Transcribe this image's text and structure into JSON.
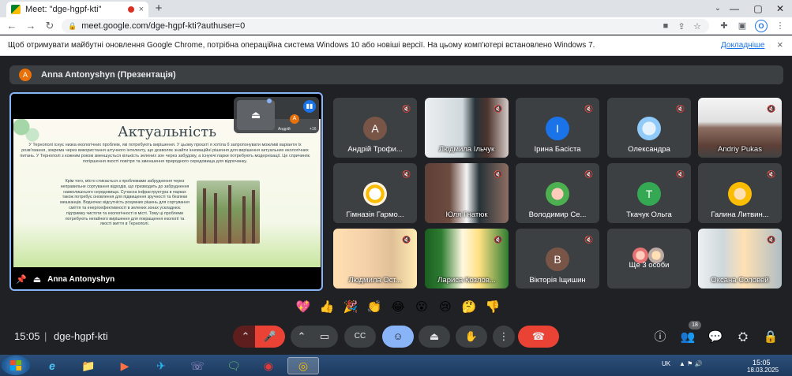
{
  "browser": {
    "tab_title": "Meet: \"dge-hgpf-kti\"",
    "tab_close": "×",
    "new_tab": "+",
    "url": "meet.google.com/dge-hgpf-kti?authuser=0",
    "profile_initial": "O",
    "icons": {
      "back": "←",
      "forward": "→",
      "reload": "↻",
      "lock": "🔒",
      "camera": "■",
      "share": "⇪",
      "star": "☆",
      "extensions": "✚",
      "sidebar": "▣",
      "menu": "⋮",
      "tab_search": "⌄",
      "minimize": "—",
      "maximize": "▢",
      "close": "✕"
    }
  },
  "infobar": {
    "message": "Щоб отримувати майбутні оновлення Google Chrome, потрібна операційна система Windows 10 або новіші версії. На цьому комп'ютері встановлено Windows 7.",
    "link": "Докладніше",
    "close": "×"
  },
  "meet": {
    "presenter_initial": "A",
    "presenter_banner": "Anna Antonyshyn (Презентація)",
    "presentation": {
      "presenter_name": "Anna Antonyshyn",
      "slide_title": "Актуальність",
      "slide_text_1": "У Тернополі існує низка екологічних проблем, які потребують вирішення. У цьому проєкті я хотіла б запропонувати можливі варіанти їх розв'язання, зокрема через використання штучного інтелекту, що дозволяє знайти інноваційні рішення для вирішення актуальних екологічних питань. У Тернополі з кожним роком зменшується кількість зелених зон через забудову, а існуючі парки потребують модернізації. Це спричиняє погіршення якості повітря та зменшення природного середовища для відпочинку.",
      "slide_text_2": "Крім того, місто стикається з проблемами забруднення через неправильне сортування відходів, що призводить до забруднення навколишнього середовища. Сучасна інфраструктура в парках також потребує оновлення для підвищення зручності та безпеки мешканців. Водночас відсутність розумних рішень для сортування сміття та енергоефективності в зелених зонах ускладнює підтримку чистоти та екологічності в місті. Тому ці проблеми потребують негайного вирішення для покращення екології та якості життя в Тернополі.",
      "mini_name": "Андрій",
      "mini_avatar": "A",
      "mini_count": "+16",
      "icons": {
        "pin": "📌",
        "present": "⏏",
        "speaking": "▮▮"
      }
    },
    "participants": [
      {
        "name": "Андрій Трофи...",
        "avatar": "A",
        "avatar_color": "#795548",
        "video": false
      },
      {
        "name": "Людмила Ільчук",
        "avatar": "",
        "avatar_color": "",
        "video": true
      },
      {
        "name": "Ірина Басіста",
        "avatar": "I",
        "avatar_color": "#1a73e8",
        "video": false
      },
      {
        "name": "Олександра",
        "avatar": "",
        "avatar_color": "#bbdefb",
        "video": false
      },
      {
        "name": "Andriy Pukas",
        "avatar": "",
        "avatar_color": "",
        "video": true
      },
      {
        "name": "Гімназія Гармо...",
        "avatar": "",
        "avatar_color": "#fff3e0",
        "video": false
      },
      {
        "name": "Юля Гнатюк",
        "avatar": "",
        "avatar_color": "",
        "video": true
      },
      {
        "name": "Володимир Се...",
        "avatar": "",
        "avatar_color": "#4caf50",
        "video": false
      },
      {
        "name": "Ткачук Ольга",
        "avatar": "T",
        "avatar_color": "#34a853",
        "video": false
      },
      {
        "name": "Галина Литвин...",
        "avatar": "",
        "avatar_color": "#fbbc04",
        "video": false
      },
      {
        "name": "Людмила Ост...",
        "avatar": "",
        "avatar_color": "",
        "video": true
      },
      {
        "name": "Лариса Козлов...",
        "avatar": "",
        "avatar_color": "",
        "video": true
      },
      {
        "name": "Вікторія Іщишин",
        "avatar": "В",
        "avatar_color": "#795548",
        "video": false
      },
      {
        "name": "Ще 3 особи",
        "avatar": "",
        "avatar_color": "",
        "video": false
      },
      {
        "name": "Оксана Соловей",
        "avatar": "",
        "avatar_color": "",
        "video": true
      }
    ],
    "reactions": [
      "💖",
      "👍",
      "🎉",
      "👏",
      "😂",
      "😮",
      "😢",
      "🤔",
      "👎"
    ],
    "time": "15:05",
    "separator": "|",
    "meeting_code": "dge-hgpf-kti",
    "participant_count": "18",
    "controls": {
      "mic_menu": "⌃",
      "mic": "🎤",
      "cam_menu": "⌃",
      "camera": "▭",
      "captions": "CC",
      "emoji": "☺",
      "present": "⏏",
      "hand": "✋",
      "more": "⋮",
      "leave": "☎",
      "info": "ⓘ",
      "people": "👥",
      "chat": "💬",
      "activities": "⛭",
      "host": "🔒"
    }
  },
  "taskbar": {
    "apps": [
      "e",
      "📁",
      "▶",
      "✈",
      "☏",
      "🗨",
      "◉",
      "◎"
    ],
    "lang": "UK",
    "tray_icons": "▲ ⚑ 🔊",
    "time": "15:05",
    "date": "18.03.2025"
  }
}
